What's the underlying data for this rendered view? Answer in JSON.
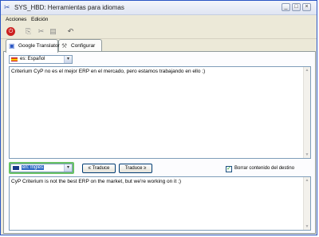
{
  "window": {
    "title": "SYS_HBD: Herramientas para idiomas"
  },
  "menu": [
    "Acciones",
    "Edición"
  ],
  "toolbar": {
    "icons": [
      "power-icon",
      "copy-icon",
      "cut-icon",
      "paste-icon",
      "undo-icon"
    ]
  },
  "tabs": [
    {
      "label": "Google Translator",
      "icon": "translator-icon",
      "active": true
    },
    {
      "label": "Configurar",
      "icon": "tools-icon",
      "active": false
    }
  ],
  "source": {
    "language": "es: Español",
    "text": "Criterium CyP no es el mejor ERP en el mercado, pero estamos trabajando en ello ;)"
  },
  "target": {
    "language": "en: Inglés",
    "text": "CyP Criterium is not the best ERP on the market, but we're working on it ;)"
  },
  "buttons": {
    "translate_back": "≤ Traduce",
    "translate_forward": "Traduce ≥"
  },
  "options": {
    "clear_target_label": "Borrar contenido del destino",
    "clear_target_checked": true
  },
  "colors": {
    "title_accent": "#2a56c4",
    "focus": "#68c264",
    "power": "#cc2020"
  }
}
